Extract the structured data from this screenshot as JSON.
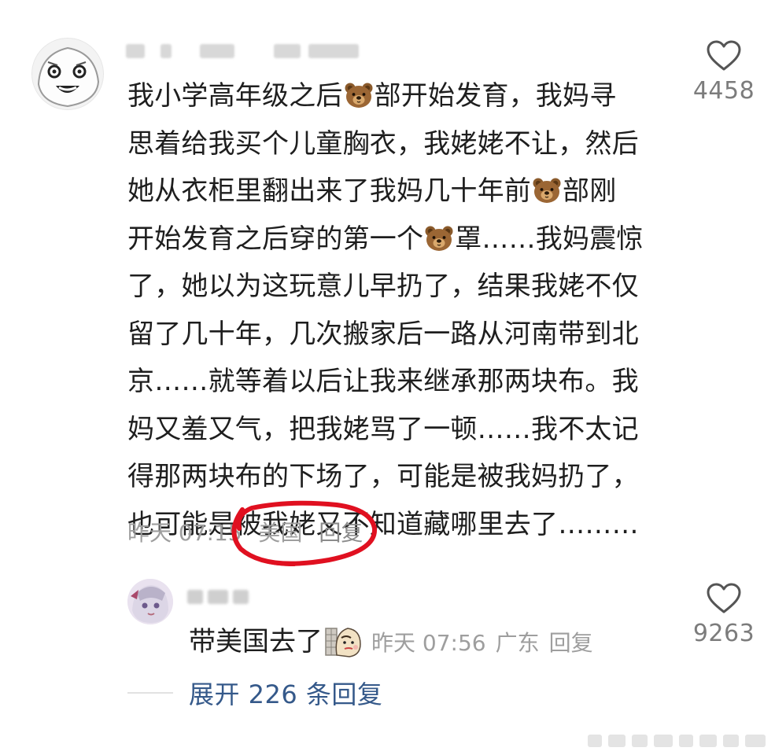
{
  "comment": {
    "lines": [
      [
        "我小学高年级之后",
        "bear",
        "部开始发育，我妈寻"
      ],
      [
        "思着给我买个儿童胸衣，我姥姥不让，然后"
      ],
      [
        "她从衣柜里翻出来了我妈几十年前",
        "bear",
        "部刚"
      ],
      [
        "开始发育之后穿的第一个",
        "bear",
        "罩……我妈震惊"
      ],
      [
        "了，她以为这玩意儿早扔了，结果我姥不仅"
      ],
      [
        "留了几十年，几次搬家后一路从河南带到北"
      ],
      [
        "京……就等着以后让我来继承那两块布。我"
      ],
      [
        "妈又羞又气，把我姥骂了一顿……我不太记"
      ],
      [
        "得那两块布的下场了，可能是被我妈扔了，"
      ],
      [
        "也可能是被我姥又不知道藏哪里去了………"
      ]
    ],
    "time": "昨天 07:15",
    "location": "美国",
    "reply_label": "回复",
    "likes": "4458"
  },
  "reply": {
    "text": "带美国去了",
    "time": "昨天 07:56",
    "location": "广东",
    "reply_label": "回复",
    "likes": "9263"
  },
  "expand": {
    "label": "展开 226 条回复"
  },
  "icons": {
    "heart": "heart-outline-icon",
    "bear": "bear-face-emoji",
    "sticker": "cartoon-sticker"
  },
  "colors": {
    "text": "#1e1e1e",
    "meta": "#9e9e9e",
    "link": "#35598a",
    "annotation": "#e01020"
  }
}
